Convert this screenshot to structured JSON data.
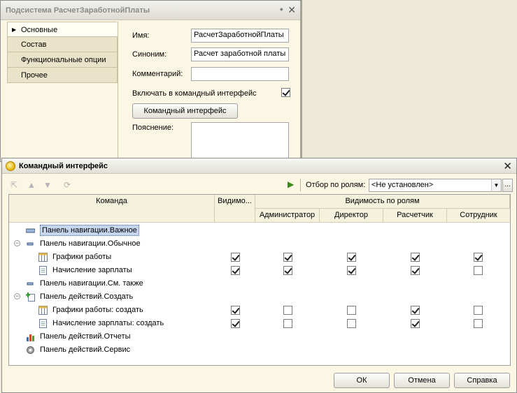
{
  "subsystem_window": {
    "title": "Подсистема РасчетЗаработнойПлаты",
    "tabs": [
      {
        "label": "Основные"
      },
      {
        "label": "Состав"
      },
      {
        "label": "Функциональные опции"
      },
      {
        "label": "Прочее"
      }
    ],
    "fields": {
      "name_label": "Имя:",
      "name_value": "РасчетЗаработнойПлаты",
      "synonym_label": "Синоним:",
      "synonym_value": "Расчет заработной платы",
      "comment_label": "Комментарий:",
      "comment_value": "",
      "include_label": "Включать в командный интерфейс",
      "include_checked": true,
      "cmd_interface_button": "Командный интерфейс",
      "explanation_label": "Пояснение:",
      "explanation_value": ""
    }
  },
  "command_dialog": {
    "title": "Командный интерфейс",
    "toolbar": {
      "filter_label": "Отбор по ролям:",
      "filter_value": "<Не установлен>",
      "more_button": "..."
    },
    "columns": {
      "command": "Команда",
      "visibility": "Видимо...",
      "visibility_by_roles": "Видимость по ролям",
      "roles": [
        "Администратор",
        "Директор",
        "Расчетчик",
        "Сотрудник"
      ]
    },
    "rows": [
      {
        "label": "Панель навигации.Важное",
        "level": 0,
        "icon": "nav-panel-icon",
        "selected": true,
        "visible": null,
        "roles": [
          null,
          null,
          null,
          null
        ]
      },
      {
        "label": "Панель навигации.Обычное",
        "level": 0,
        "icon": "nav-panel-small-icon",
        "expander": "⊖",
        "visible": null,
        "roles": [
          null,
          null,
          null,
          null
        ]
      },
      {
        "label": "Графики работы",
        "level": 1,
        "icon": "table-icon",
        "visible": true,
        "roles": [
          true,
          true,
          true,
          true
        ]
      },
      {
        "label": "Начисление зарплаты",
        "level": 1,
        "icon": "document-icon",
        "visible": true,
        "roles": [
          true,
          true,
          true,
          false
        ]
      },
      {
        "label": "Панель навигации.См. также",
        "level": 0,
        "icon": "nav-panel-small-icon",
        "visible": null,
        "roles": [
          null,
          null,
          null,
          null
        ]
      },
      {
        "label": "Панель действий.Создать",
        "level": 0,
        "icon": "create-icon",
        "expander": "⊖",
        "visible": null,
        "roles": [
          null,
          null,
          null,
          null
        ]
      },
      {
        "label": "Графики работы: создать",
        "level": 1,
        "icon": "table-icon",
        "visible": true,
        "roles": [
          false,
          false,
          true,
          false
        ]
      },
      {
        "label": "Начисление зарплаты: создать",
        "level": 1,
        "icon": "document-icon",
        "visible": true,
        "roles": [
          false,
          false,
          true,
          false
        ]
      },
      {
        "label": "Панель действий.Отчеты",
        "level": 0,
        "icon": "chart-icon",
        "visible": null,
        "roles": [
          null,
          null,
          null,
          null
        ]
      },
      {
        "label": "Панель действий.Сервис",
        "level": 0,
        "icon": "gear-icon",
        "visible": null,
        "roles": [
          null,
          null,
          null,
          null
        ]
      }
    ],
    "buttons": {
      "ok": "ОК",
      "cancel": "Отмена",
      "help": "Справка"
    }
  }
}
